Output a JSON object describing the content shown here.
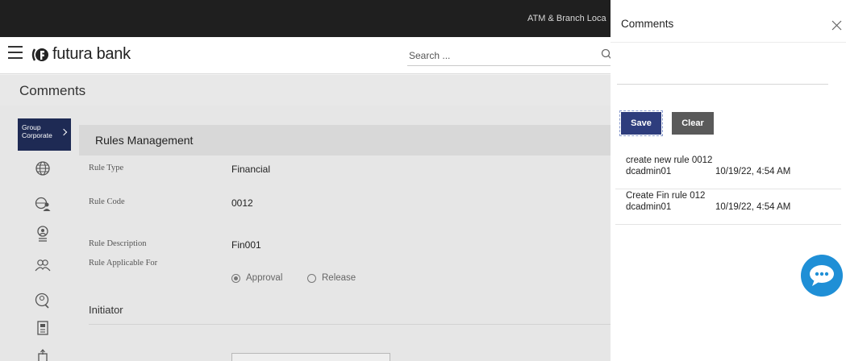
{
  "topbar": {
    "atm_label": "ATM & Branch Loca"
  },
  "header": {
    "logo_text": "futura bank",
    "search_placeholder": "Search ..."
  },
  "page": {
    "title": "Comments"
  },
  "sidebar": {
    "group_label_1": "Group",
    "group_label_2": "Corporate"
  },
  "rules": {
    "section_title": "Rules Management",
    "fields": [
      {
        "label": "Rule Type",
        "value": "Financial"
      },
      {
        "label": "Rule Code",
        "value": "0012"
      },
      {
        "label": "Rule Description",
        "value": "Fin001"
      },
      {
        "label": "Rule Applicable For",
        "value": ""
      }
    ],
    "options": [
      {
        "label": "Approval",
        "selected": true
      },
      {
        "label": "Release",
        "selected": false
      }
    ],
    "initiator_title": "Initiator"
  },
  "panel": {
    "title": "Comments",
    "input_value": "",
    "save_label": "Save",
    "clear_label": "Clear",
    "comments": [
      {
        "text": "create new rule 0012",
        "user": "dcadmin01",
        "timestamp": "10/19/22, 4:54 AM"
      },
      {
        "text": "Create Fin rule 012",
        "user": "dcadmin01",
        "timestamp": "10/19/22, 4:54 AM"
      }
    ]
  },
  "icons": {
    "menu": "hamburger-icon",
    "logo": "futura-logo-icon",
    "search": "search-icon",
    "close": "close-icon",
    "chat": "chat-bubble-icon"
  },
  "colors": {
    "topbar": "#1f1f1f",
    "group_nav": "#1e2a54",
    "save": "#2e3d7d",
    "clear": "#5a5a5a",
    "chat": "#1f8fd6"
  }
}
